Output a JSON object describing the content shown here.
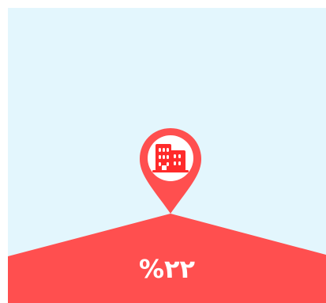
{
  "stat": {
    "percent_label": "%۲۲",
    "icon": "building-icon"
  },
  "colors": {
    "background": "#e3f6fd",
    "accent": "#ff4f4f",
    "text": "#ffffff"
  }
}
